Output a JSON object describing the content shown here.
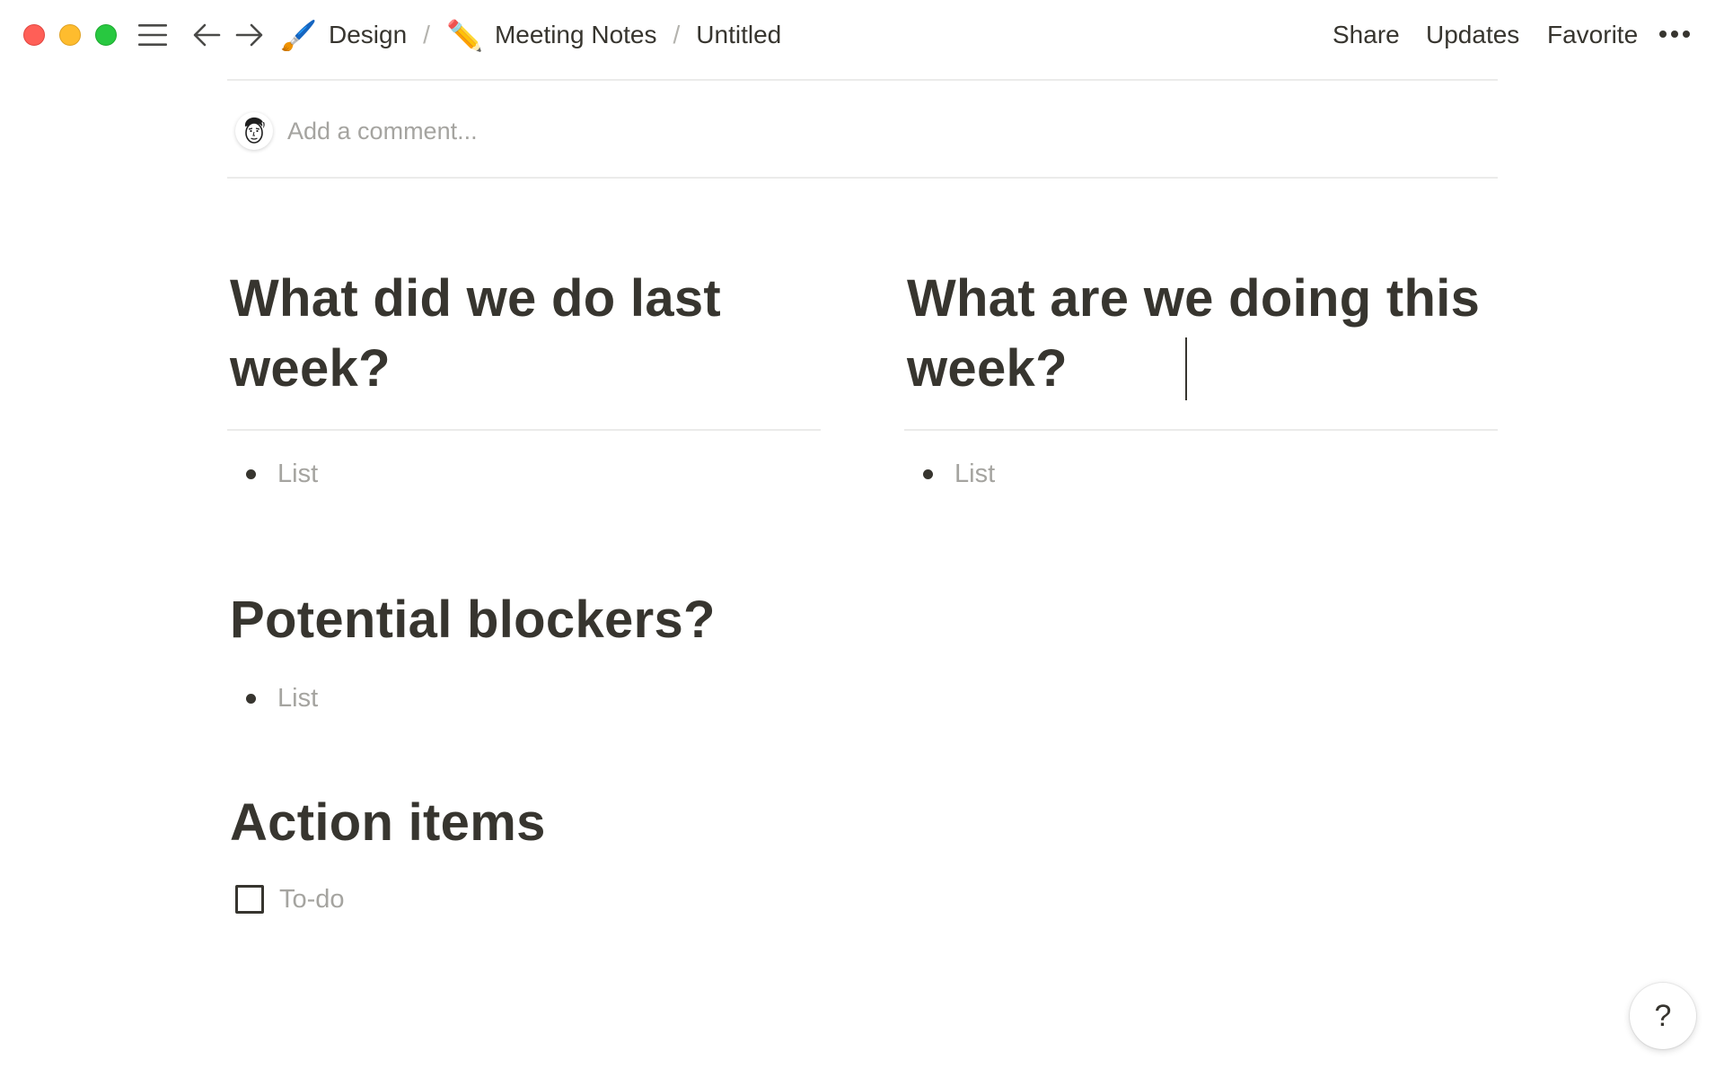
{
  "window": {
    "traffic_lights": [
      "close",
      "minimize",
      "zoom"
    ]
  },
  "nav": {
    "menu_icon": "hamburger-icon",
    "back_icon": "arrow-left-icon",
    "forward_icon": "arrow-right-icon"
  },
  "breadcrumb": [
    {
      "emoji": "🖌️",
      "icon": "paintbrush-icon",
      "label": "Design"
    },
    {
      "emoji": "✏️",
      "icon": "pencil-icon",
      "label": "Meeting Notes"
    },
    {
      "label": "Untitled"
    }
  ],
  "breadcrumb_separator": "/",
  "topbar": {
    "share_label": "Share",
    "updates_label": "Updates",
    "favorite_label": "Favorite",
    "more_icon": "ellipsis-icon"
  },
  "comment": {
    "placeholder": "Add a comment...",
    "avatar_icon": "user-avatar-icon"
  },
  "sections": {
    "last_week": {
      "heading": "What did we do last week?",
      "item_placeholder": "List"
    },
    "this_week": {
      "heading": "What are we doing this week?",
      "item_placeholder": "List"
    },
    "blockers": {
      "heading": "Potential blockers?",
      "item_placeholder": "List"
    },
    "action_items": {
      "heading": "Action items",
      "todo_placeholder": "To-do",
      "checked": false
    }
  },
  "help": {
    "label": "?"
  },
  "colors": {
    "text": "#37352f",
    "placeholder": "#a5a4a0",
    "divider": "#ebebea",
    "close": "#ff5f57",
    "minimize": "#febc2e",
    "zoom": "#28c840"
  }
}
